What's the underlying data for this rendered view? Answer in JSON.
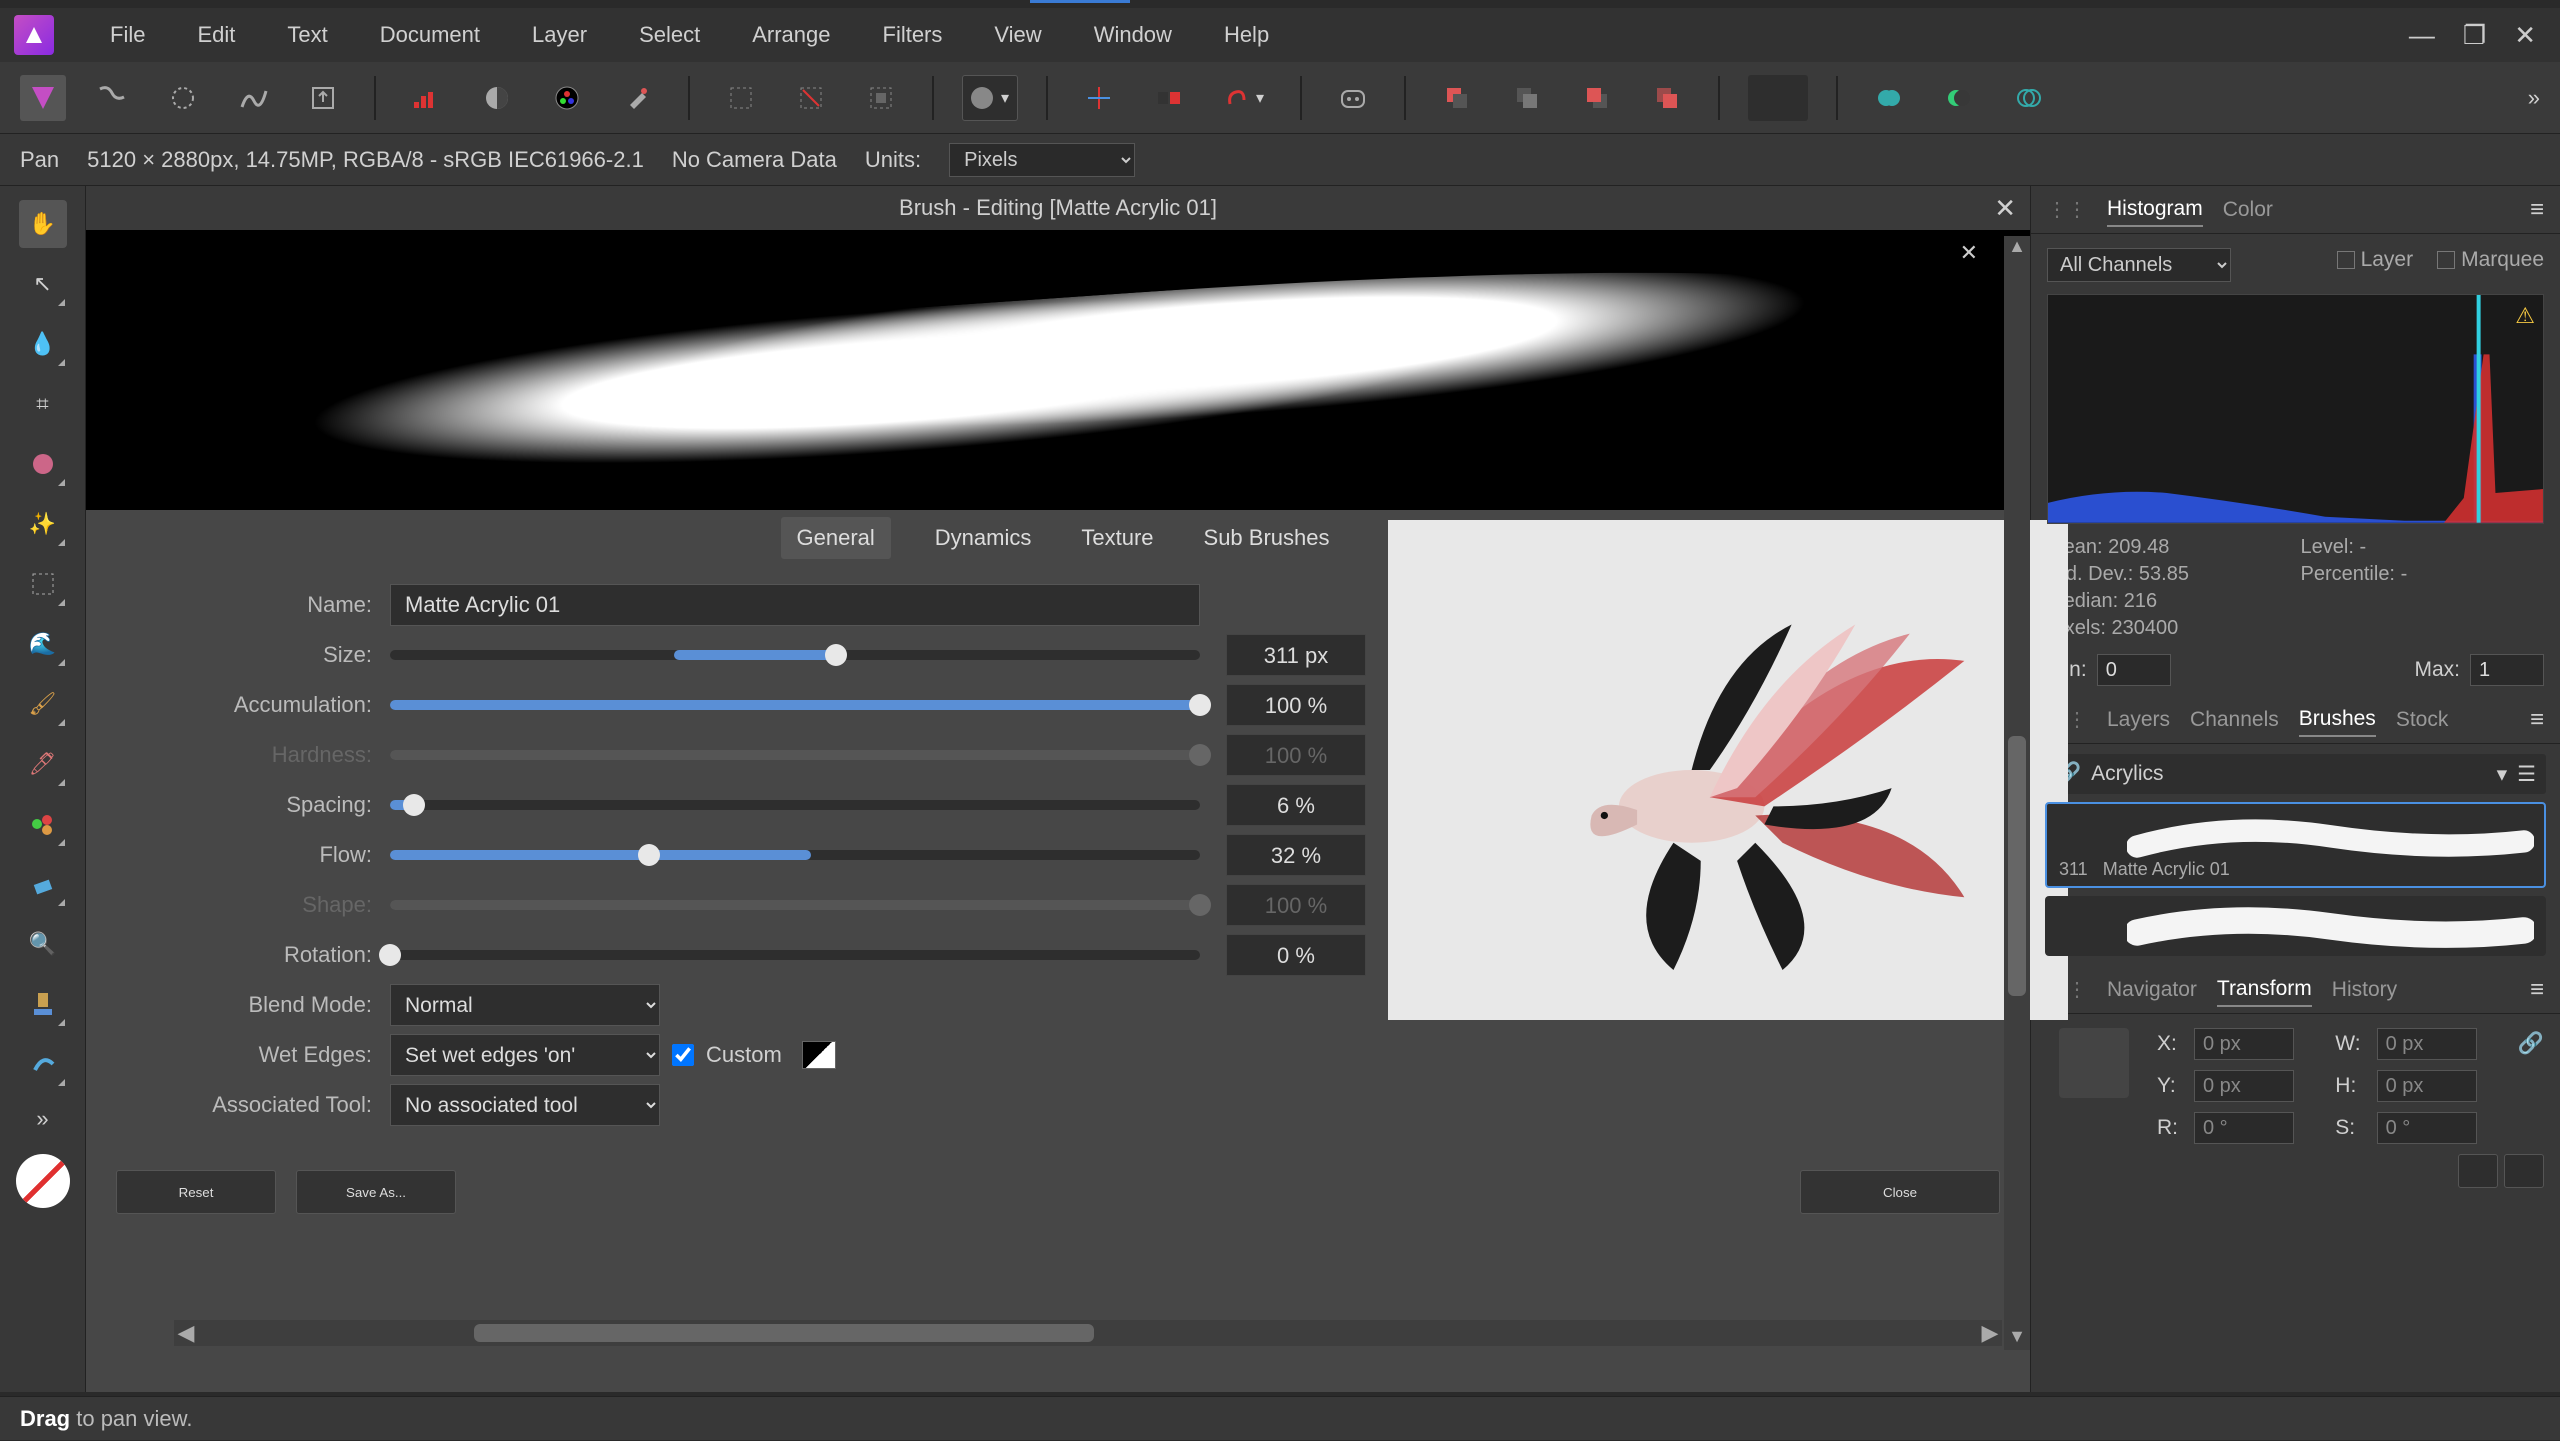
{
  "menu": [
    "File",
    "Edit",
    "Text",
    "Document",
    "Layer",
    "Select",
    "Arrange",
    "Filters",
    "View",
    "Window",
    "Help"
  ],
  "infobar": {
    "tool": "Pan",
    "doc": "5120 × 2880px, 14.75MP, RGBA/8 - sRGB IEC61966-2.1",
    "camera": "No Camera Data",
    "units_label": "Units:",
    "units_value": "Pixels"
  },
  "dialog": {
    "title": "Brush - Editing [Matte Acrylic 01]",
    "tabs": [
      "General",
      "Dynamics",
      "Texture",
      "Sub Brushes"
    ],
    "active_tab": "General",
    "name_label": "Name:",
    "name_value": "Matte Acrylic 01",
    "sliders": [
      {
        "label": "Size:",
        "value": "311 px",
        "pct": 55,
        "disabled": false,
        "fill_from": 35
      },
      {
        "label": "Accumulation:",
        "value": "100 %",
        "pct": 100,
        "disabled": false
      },
      {
        "label": "Hardness:",
        "value": "100 %",
        "pct": 100,
        "disabled": true
      },
      {
        "label": "Spacing:",
        "value": "6 %",
        "pct": 3,
        "disabled": false
      },
      {
        "label": "Flow:",
        "value": "32 %",
        "pct": 32,
        "disabled": false,
        "fill_to": 52
      },
      {
        "label": "Shape:",
        "value": "100 %",
        "pct": 100,
        "disabled": true
      },
      {
        "label": "Rotation:",
        "value": "0 %",
        "pct": 0,
        "disabled": false
      }
    ],
    "blend_label": "Blend Mode:",
    "blend_value": "Normal",
    "wet_label": "Wet Edges:",
    "wet_value": "Set wet edges 'on'",
    "custom_label": "Custom",
    "assoc_label": "Associated Tool:",
    "assoc_value": "No associated tool",
    "reset": "Reset",
    "saveas": "Save As...",
    "close": "Close"
  },
  "histogram": {
    "tabs": [
      "Histogram",
      "Color"
    ],
    "channel": "All Channels",
    "opt_layer": "Layer",
    "opt_marquee": "Marquee",
    "stats": {
      "mean_l": "Mean:",
      "mean_v": "209.48",
      "sd_l": "Std. Dev.:",
      "sd_v": "53.85",
      "med_l": "Median:",
      "med_v": "216",
      "px_l": "Pixels:",
      "px_v": "230400",
      "lvl_l": "Level:",
      "lvl_v": "-",
      "pct_l": "Percentile:",
      "pct_v": "-"
    },
    "min_l": "Min:",
    "min_v": "0",
    "max_l": "Max:",
    "max_v": "1"
  },
  "brushes": {
    "tabs": [
      "Layers",
      "Channels",
      "Brushes",
      "Stock"
    ],
    "category": "Acrylics",
    "items": [
      {
        "size": "311",
        "name": "Matte Acrylic 01",
        "selected": true
      },
      {
        "size": "",
        "name": "",
        "selected": false
      }
    ]
  },
  "transform": {
    "tabs": [
      "Navigator",
      "Transform",
      "History"
    ],
    "x_l": "X:",
    "x_v": "0 px",
    "y_l": "Y:",
    "y_v": "0 px",
    "w_l": "W:",
    "w_v": "0 px",
    "h_l": "H:",
    "h_v": "0 px",
    "r_l": "R:",
    "r_v": "0 °",
    "s_l": "S:",
    "s_v": "0 °"
  },
  "status": {
    "bold": "Drag",
    "rest": " to pan view."
  }
}
